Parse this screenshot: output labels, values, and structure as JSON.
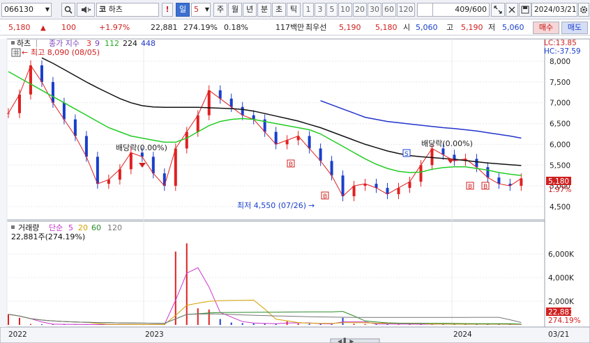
{
  "toolbar": {
    "code": "066130",
    "market_tag": "코",
    "name": "하츠",
    "period_buttons": [
      "일",
      "5",
      "주",
      "월",
      "년",
      "분",
      "초",
      "틱"
    ],
    "num_buttons": [
      "1",
      "3",
      "5",
      "10",
      "20",
      "30",
      "60",
      "120"
    ],
    "count": "409",
    "count_total": "/600",
    "date": "2024/03/21"
  },
  "quote": {
    "price": "5,180",
    "change": "100",
    "change_pct": "+1.97%",
    "volume": "22,881",
    "volume_pct": "274.19%",
    "turnover": "0.18%",
    "amount": "117백만",
    "best_ask_label": "최우선",
    "best_ask": "5,190",
    "best_bid": "5,180",
    "open_label": "시",
    "open": "5,060",
    "high_label": "고",
    "high": "5,190",
    "low_label": "저",
    "low": "5,060",
    "buy_label": "매수",
    "sell_label": "매도",
    "colors": {
      "up": "#d02020",
      "down": "#1a3fcc"
    }
  },
  "price_panel": {
    "title": "하츠",
    "ma_label": "종가 지수",
    "ma_periods": [
      "3",
      "9",
      "112",
      "224",
      "448"
    ],
    "ma_colors": [
      "#e02020",
      "#7b3fb8",
      "#22cc22",
      "#111111",
      "#2233cc"
    ],
    "high_note": "최고 8,090 (08/05)",
    "low_note": "최저 4,550 (07/26)",
    "dividend_left": "배당락(0.00%)",
    "dividend_right": "배당락(0.00%)",
    "lc": "LC:13.85",
    "hc": "HC:-37.59",
    "current_price": "5,180",
    "current_pct": "1.97%"
  },
  "volume_panel": {
    "title": "거래량",
    "ma_label": "단순",
    "ma_periods": [
      "5",
      "20",
      "60",
      "120"
    ],
    "ma_colors": [
      "#cc33cc",
      "#d4a100",
      "#2a8a2a",
      "#777777"
    ],
    "summary": "22,881주(274.19%)",
    "current_volume": "22,881",
    "current_pct": "274.19%"
  },
  "x_axis": {
    "labels": [
      "2022",
      "2023",
      "2024",
      "03/21"
    ]
  },
  "chart_data": {
    "type": "line",
    "title": "하츠",
    "y_axis": {
      "min": 4500,
      "max": 8000,
      "ticks": [
        4500,
        5000,
        5500,
        6000,
        6500,
        7000,
        7500,
        8000
      ],
      "tick_labels": [
        "4,500",
        "5,000",
        "5,500",
        "6,000",
        "6,500",
        "7,000",
        "7,500",
        "8,000"
      ]
    },
    "x_labels": [
      "2022",
      "2023",
      "2024",
      "03/21"
    ],
    "series": [
      {
        "name": "종가",
        "values": [
          6750,
          7200,
          7900,
          7500,
          7000,
          6600,
          6200,
          5700,
          5050,
          5150,
          5400,
          5800,
          5700,
          5300,
          5000,
          5900,
          6300,
          6700,
          7300,
          7100,
          6900,
          6700,
          6600,
          6300,
          6000,
          6100,
          6200,
          5900,
          5600,
          5250,
          4750,
          5000,
          5050,
          4950,
          4800,
          4950,
          5100,
          5500,
          5900,
          5750,
          5600,
          5650,
          5450,
          5200,
          5050,
          5000,
          5180
        ]
      },
      {
        "name": "112",
        "values": [
          7750,
          7600,
          7450,
          7300,
          7150,
          7000,
          6850,
          6700,
          6550,
          6400,
          6300,
          6200,
          6150,
          6100,
          6050,
          6050,
          6150,
          6300,
          6450,
          6550,
          6600,
          6620,
          6600,
          6550,
          6500,
          6450,
          6400,
          6350,
          6250,
          6100,
          5950,
          5800,
          5650,
          5520,
          5420,
          5350,
          5320,
          5330,
          5400,
          5440,
          5460,
          5460,
          5420,
          5380,
          5320,
          5280,
          5250
        ]
      },
      {
        "name": "224",
        "values": [
          null,
          null,
          null,
          8080,
          7950,
          7800,
          7650,
          7500,
          7360,
          7230,
          7100,
          7000,
          6930,
          6900,
          6890,
          6890,
          6890,
          6890,
          6880,
          6870,
          6860,
          6840,
          6800,
          6740,
          6680,
          6620,
          6560,
          6480,
          6400,
          6300,
          6200,
          6100,
          6000,
          5920,
          5840,
          5780,
          5730,
          5700,
          5680,
          5660,
          5640,
          5610,
          5580,
          5550,
          5530,
          5510,
          5490
        ]
      },
      {
        "name": "448",
        "values": [
          null,
          null,
          null,
          null,
          null,
          null,
          null,
          null,
          null,
          null,
          null,
          null,
          null,
          null,
          null,
          null,
          null,
          null,
          null,
          null,
          null,
          null,
          null,
          null,
          null,
          null,
          null,
          null,
          7050,
          6950,
          6850,
          6750,
          6650,
          6600,
          6550,
          6520,
          6490,
          6460,
          6430,
          6400,
          6380,
          6350,
          6320,
          6280,
          6240,
          6200,
          6150
        ]
      }
    ],
    "volume": {
      "y_axis": {
        "ticks": [
          2000,
          4000,
          6000
        ],
        "tick_labels": [
          "2,000K",
          "4,000K",
          "6,000K"
        ],
        "max": 7000
      },
      "values_k": [
        900,
        600,
        80,
        60,
        50,
        40,
        30,
        30,
        30,
        40,
        30,
        30,
        30,
        40,
        30,
        6200,
        6900,
        1400,
        1300,
        500,
        200,
        150,
        120,
        100,
        100,
        300,
        120,
        100,
        90,
        80,
        600,
        100,
        80,
        70,
        70,
        60,
        60,
        60,
        80,
        70,
        70,
        60,
        60,
        60,
        50,
        50,
        23
      ]
    }
  }
}
